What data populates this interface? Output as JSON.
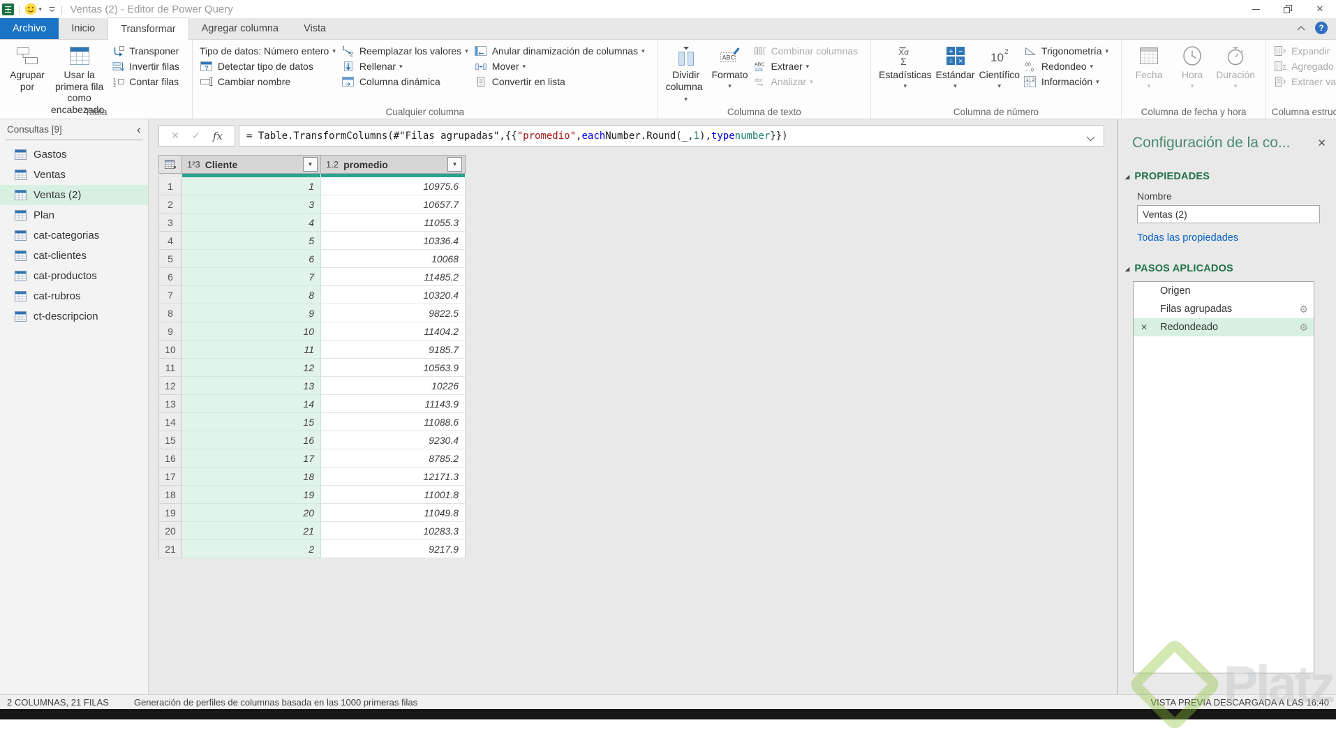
{
  "window": {
    "title": "Ventas (2) - Editor de Power Query"
  },
  "tabs": [
    {
      "label": "Archivo",
      "type": "file"
    },
    {
      "label": "Inicio"
    },
    {
      "label": "Transformar",
      "active": true
    },
    {
      "label": "Agregar columna"
    },
    {
      "label": "Vista"
    }
  ],
  "ribbon": {
    "groups": [
      {
        "label": "Tabla",
        "items": [
          {
            "kind": "big",
            "icon": "group-by-icon",
            "label": "Agrupar\npor"
          },
          {
            "kind": "big",
            "icon": "first-row-header-icon",
            "label": "Usar la primera fila\ncomo encabezado",
            "arrow": true
          },
          {
            "kind": "stack",
            "buttons": [
              {
                "icon": "transpose-icon",
                "label": "Transponer"
              },
              {
                "icon": "invert-rows-icon",
                "label": "Invertir filas"
              },
              {
                "icon": "count-rows-icon",
                "label": "Contar filas"
              }
            ]
          }
        ]
      },
      {
        "label": "Cualquier columna",
        "items": [
          {
            "kind": "stack",
            "buttons": [
              {
                "label": "Tipo de datos: Número entero",
                "arrow": true
              },
              {
                "icon": "detect-type-icon",
                "label": "Detectar tipo de datos"
              },
              {
                "icon": "rename-icon",
                "label": "Cambiar nombre"
              }
            ]
          },
          {
            "kind": "stack",
            "buttons": [
              {
                "icon": "replace-values-icon",
                "label": "Reemplazar los valores",
                "arrow": true
              },
              {
                "icon": "fill-icon",
                "label": "Rellenar",
                "arrow": true
              },
              {
                "icon": "pivot-icon",
                "label": "Columna dinámica"
              }
            ]
          },
          {
            "kind": "stack",
            "buttons": [
              {
                "icon": "unpivot-icon",
                "label": "Anular dinamización de columnas",
                "arrow": true
              },
              {
                "icon": "move-icon",
                "label": "Mover",
                "arrow": true
              },
              {
                "icon": "list-icon",
                "label": "Convertir en lista"
              }
            ]
          }
        ]
      },
      {
        "label": "Columna de texto",
        "items": [
          {
            "kind": "big",
            "icon": "split-column-icon",
            "label": "Dividir\ncolumna",
            "arrow": true
          },
          {
            "kind": "big",
            "icon": "format-icon",
            "label": "Formato",
            "arrow": true
          },
          {
            "kind": "stack",
            "buttons": [
              {
                "icon": "combine-icon",
                "label": "Combinar columnas",
                "disabled": true
              },
              {
                "icon": "extract-icon",
                "label": "Extraer",
                "arrow": true
              },
              {
                "icon": "analyze-icon",
                "label": "Analizar",
                "arrow": true,
                "disabled": true
              }
            ]
          }
        ]
      },
      {
        "label": "Columna de número",
        "items": [
          {
            "kind": "big",
            "icon": "statistics-icon",
            "label": "Estadísticas",
            "arrow": true
          },
          {
            "kind": "big",
            "icon": "standard-icon",
            "label": "Estándar",
            "arrow": true
          },
          {
            "kind": "big",
            "icon": "scientific-icon",
            "label": "Científico",
            "arrow": true
          },
          {
            "kind": "stack",
            "buttons": [
              {
                "icon": "trigonometry-icon",
                "label": "Trigonometría",
                "arrow": true
              },
              {
                "icon": "rounding-icon",
                "label": "Redondeo",
                "arrow": true
              },
              {
                "icon": "information-icon",
                "label": "Información",
                "arrow": true
              }
            ]
          }
        ]
      },
      {
        "label": "Columna de fecha y hora",
        "items": [
          {
            "kind": "big",
            "icon": "date-icon",
            "label": "Fecha",
            "arrow": true,
            "disabled": true
          },
          {
            "kind": "big",
            "icon": "time-icon",
            "label": "Hora",
            "arrow": true,
            "disabled": true
          },
          {
            "kind": "big",
            "icon": "duration-icon",
            "label": "Duración",
            "arrow": true,
            "disabled": true
          }
        ]
      },
      {
        "label": "Columna estructurada",
        "items": [
          {
            "kind": "stack",
            "buttons": [
              {
                "icon": "expand-icon",
                "label": "Expandir",
                "disabled": true
              },
              {
                "icon": "aggregate-icon",
                "label": "Agregado",
                "disabled": true
              },
              {
                "icon": "extract-values-icon",
                "label": "Extraer valores",
                "disabled": true
              }
            ]
          }
        ]
      }
    ]
  },
  "formula_bar": {
    "segments": [
      {
        "text": "= Table.TransformColumns(#\"Filas agrupadas\",{{",
        "color": "plain"
      },
      {
        "text": "\"promedio\"",
        "color": "string"
      },
      {
        "text": ", ",
        "color": "plain"
      },
      {
        "text": "each",
        "color": "keyword"
      },
      {
        "text": " Number.Round(_, ",
        "color": "plain"
      },
      {
        "text": "1",
        "color": "number"
      },
      {
        "text": "), ",
        "color": "plain"
      },
      {
        "text": "type",
        "color": "keyword"
      },
      {
        "text": " ",
        "color": "plain"
      },
      {
        "text": "number",
        "color": "number"
      },
      {
        "text": "}})",
        "color": "plain"
      }
    ]
  },
  "sidebar": {
    "header": "Consultas [9]",
    "items": [
      {
        "label": "Gastos"
      },
      {
        "label": "Ventas"
      },
      {
        "label": "Ventas (2)",
        "selected": true
      },
      {
        "label": "Plan"
      },
      {
        "label": "cat-categorias"
      },
      {
        "label": "cat-clientes"
      },
      {
        "label": "cat-productos"
      },
      {
        "label": "cat-rubros"
      },
      {
        "label": "ct-descripcion"
      }
    ]
  },
  "grid": {
    "columns": [
      {
        "type_badge": "1²3",
        "name": "Cliente",
        "selected": true
      },
      {
        "type_badge": "1.2",
        "name": "promedio",
        "selected": false
      }
    ],
    "rows": [
      [
        "1",
        "10975.6"
      ],
      [
        "3",
        "10657.7"
      ],
      [
        "4",
        "11055.3"
      ],
      [
        "5",
        "10336.4"
      ],
      [
        "6",
        "10068"
      ],
      [
        "7",
        "11485.2"
      ],
      [
        "8",
        "10320.4"
      ],
      [
        "9",
        "9822.5"
      ],
      [
        "10",
        "11404.2"
      ],
      [
        "11",
        "9185.7"
      ],
      [
        "12",
        "10563.9"
      ],
      [
        "13",
        "10226"
      ],
      [
        "14",
        "11143.9"
      ],
      [
        "15",
        "11088.6"
      ],
      [
        "16",
        "9230.4"
      ],
      [
        "17",
        "8785.2"
      ],
      [
        "18",
        "12171.3"
      ],
      [
        "19",
        "11001.8"
      ],
      [
        "20",
        "11049.8"
      ],
      [
        "21",
        "10283.3"
      ],
      [
        "2",
        "9217.9"
      ]
    ]
  },
  "right_panel": {
    "title": "Configuración de la co...",
    "properties_header": "PROPIEDADES",
    "name_label": "Nombre",
    "name_value": "Ventas (2)",
    "all_properties_link": "Todas las propiedades",
    "steps_header": "PASOS APLICADOS",
    "steps": [
      {
        "label": "Origen"
      },
      {
        "label": "Filas agrupadas",
        "gear": true
      },
      {
        "label": "Redondeado",
        "gear": true,
        "deletable": true,
        "selected": true
      }
    ]
  },
  "status_bar": {
    "left": "2 COLUMNAS, 21 FILAS",
    "middle": "Generación de perfiles de columnas basada en las 1000 primeras filas",
    "right": "VISTA PREVIA DESCARGADA A LAS 16:40"
  },
  "watermark": {
    "text": "Platzi"
  },
  "colors": {
    "accent_teal": "#2aa392",
    "selection_mint": "#d8f0e2",
    "tab_blue": "#1a73c4",
    "heading_green": "#217346",
    "watermark_green": "#8fc43c"
  }
}
